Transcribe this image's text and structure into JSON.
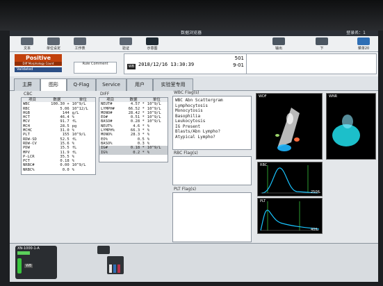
{
  "titlebar": {
    "title": "数据浏览器",
    "user": "登录名：1"
  },
  "toolbar": {
    "left": [
      {
        "label": "文本",
        "icon": "document-icon"
      },
      {
        "label": "单位设定",
        "icon": "unit-icon"
      },
      {
        "label": "工作表",
        "icon": "worksheet-icon"
      },
      {
        "label": "验证",
        "icon": "clipboard-check-icon"
      },
      {
        "label": "示意图",
        "icon": "display-icon"
      }
    ],
    "right": [
      {
        "label": "输出",
        "icon": "upload-icon"
      },
      {
        "label": "下",
        "icon": "arrow-down-icon"
      },
      {
        "label": "菜单20",
        "icon": "home-icon"
      }
    ]
  },
  "status": {
    "positive": "Positive",
    "positive_sub": "Diff Morphology Count",
    "validated": "Validated",
    "rule_comment": "Rule Comment"
  },
  "sample": {
    "mode": "WB",
    "datetime": "2018/12/16 13:30:39",
    "sample_no": "501",
    "rack_pos": "9-01"
  },
  "tabs": [
    "主屏",
    "图形",
    "Q-Flag",
    "Service",
    "用户",
    "实验室专用"
  ],
  "active_tab": 1,
  "cbc": {
    "title": "CBC",
    "headers": [
      "项目",
      "数据",
      "单位"
    ],
    "rows": [
      [
        "WBC",
        "100.30 +",
        "10^9/L"
      ],
      [
        "RBC",
        "5.06",
        "10^12/L"
      ],
      [
        "HGB",
        "144",
        "g/L"
      ],
      [
        "HCT",
        "46.4",
        "%"
      ],
      [
        "MCV",
        "91.7",
        "fL"
      ],
      [
        "MCH",
        "28.5",
        "pg"
      ],
      [
        "MCHC",
        "31.0",
        "%"
      ],
      [
        "PLT",
        "155",
        "10^9/L"
      ],
      [
        "RDW-SD",
        "52.5",
        "fL"
      ],
      [
        "RDW-CV",
        "15.6",
        "%"
      ],
      [
        "PDW",
        "15.5",
        "fL"
      ],
      [
        "MPV",
        "11.9",
        "fL"
      ],
      [
        "P-LCR",
        "35.5",
        "%"
      ],
      [
        "PCT",
        "0.18",
        "%"
      ],
      [
        "NRBC#",
        "0.00",
        "10^9/L"
      ],
      [
        "NRBC%",
        "0.0",
        "%"
      ]
    ]
  },
  "diff": {
    "title": "DIFF",
    "headers": [
      "项目",
      "数据",
      "单位"
    ],
    "rows": [
      [
        "NEUT#",
        "4.57 *",
        "10^9/L"
      ],
      [
        "LYMPH#",
        "66.52 *",
        "10^9/L"
      ],
      [
        "MONO#",
        "28.42 *",
        "10^9/L"
      ],
      [
        "EO#",
        "0.51 *",
        "10^9/L"
      ],
      [
        "BASO#",
        "0.28 *",
        "10^9/L"
      ],
      [
        "NEUT%",
        "4.6 *",
        "%"
      ],
      [
        "LYMPH%",
        "66.3 *",
        "%"
      ],
      [
        "MONO%",
        "28.3 *",
        "%"
      ],
      [
        "EO%",
        "0.5",
        "%"
      ],
      [
        "BASO%",
        "0.3",
        "%"
      ],
      [
        "IG#",
        "0.18 *",
        "10^9/L"
      ],
      [
        "IG%",
        "0.2 *",
        "%"
      ]
    ]
  },
  "wbc_flags": {
    "title": "WBC Flag(s)",
    "items": [
      "WBC Abn Scattergram",
      "Lymphocytosis",
      "Monocytosis",
      "Basophilia",
      "Leukocytosis",
      "IG Present",
      "Blasts/Abn Lympho?",
      "Atypical Lympho?"
    ]
  },
  "rbc_flags": {
    "title": "RBC Flag(s)",
    "items": []
  },
  "plt_flags": {
    "title": "PLT Flag(s)",
    "items": []
  },
  "plots": {
    "wdf": "WDF",
    "wnr": "WNR",
    "rbc": "RBC",
    "plt": "PLT",
    "rbc_axis": "250fL",
    "plt_axis": "40fL"
  },
  "analyzer": {
    "name": "XN-1000-1-A",
    "mode": "WB"
  },
  "colors": {
    "positive": "#c2410c",
    "validated": "#2c4f86",
    "led": "#39c53d",
    "rbc_curve": "#19c4ff",
    "plt_curve": "#19c4ff"
  }
}
